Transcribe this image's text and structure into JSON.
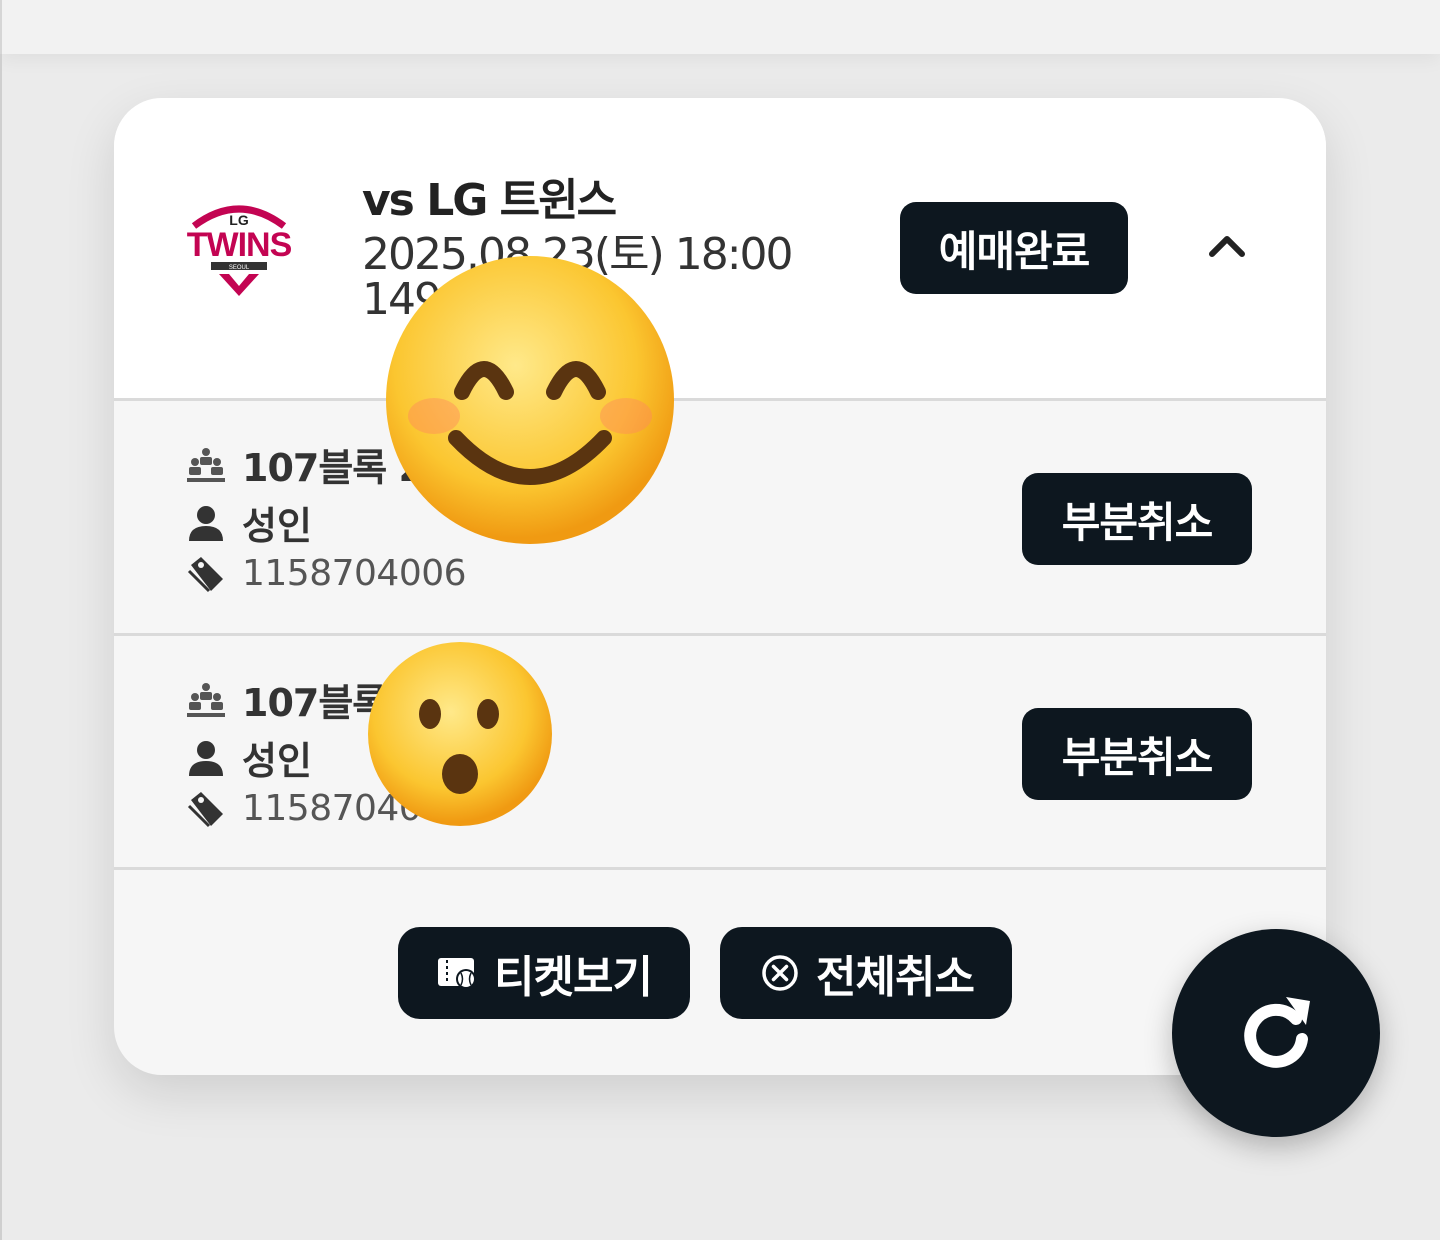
{
  "booking": {
    "opponent": "vs LG 트윈스",
    "datetime": "2025.08.23(토) 18:00",
    "extra_visible": "149",
    "status": "예매완료",
    "team_logo_name": "LG TWINS",
    "colors": {
      "dark": "#0d171f",
      "brand_red": "#c30452"
    }
  },
  "tickets": [
    {
      "seat": "107블록 2",
      "type": "성인",
      "ticket_no": "1158704006",
      "cancel_label": "부분취소"
    },
    {
      "seat": "107블록 2",
      "type": "성인",
      "ticket_no": "11587040",
      "cancel_label": "부분취소"
    }
  ],
  "footer": {
    "view_ticket": "티켓보기",
    "cancel_all": "전체취소"
  },
  "icons": {
    "collapse": "chevron-up-icon",
    "seat": "seats-icon",
    "person": "person-icon",
    "tag": "tag-icon",
    "ticket": "ticket-icon",
    "cancel": "circle-x-icon",
    "refresh": "refresh-icon"
  }
}
